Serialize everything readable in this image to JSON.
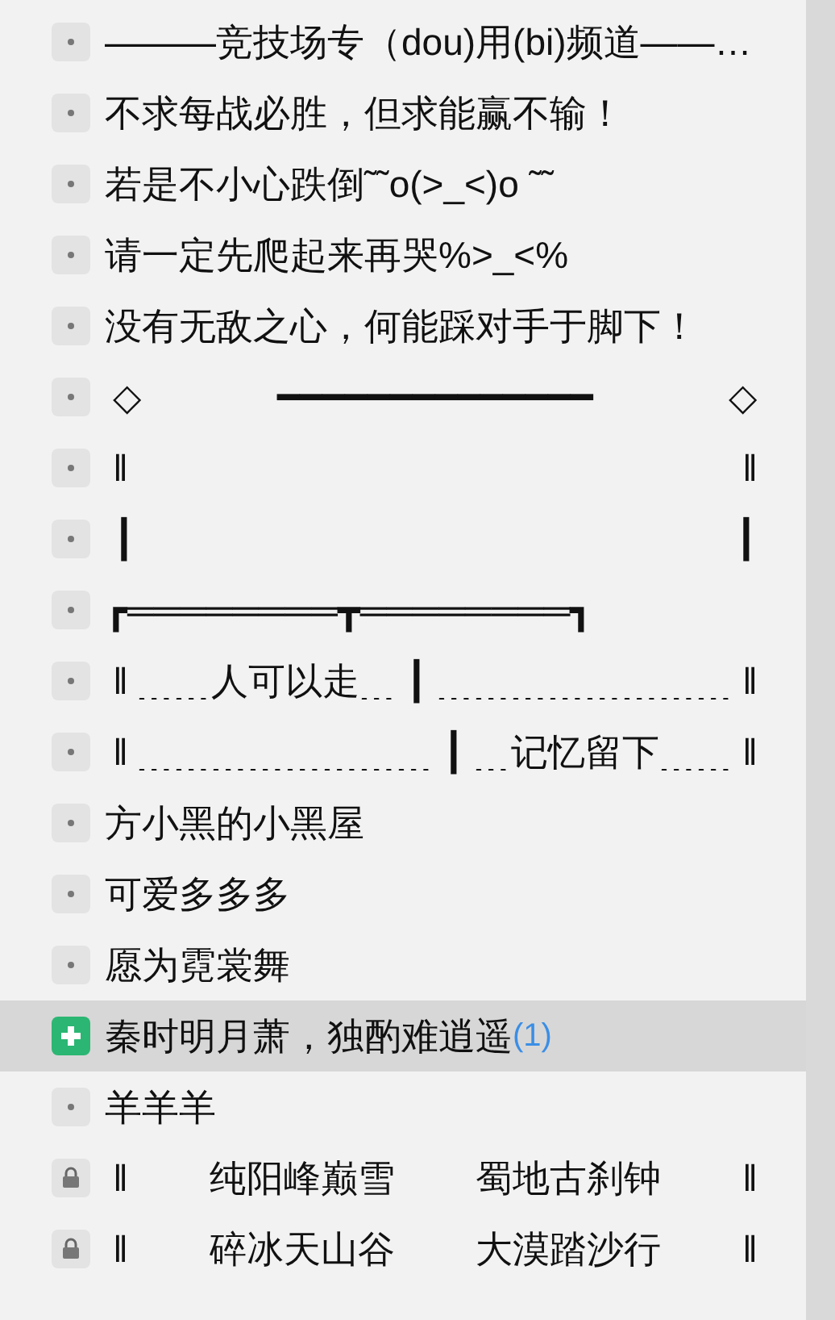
{
  "channels": [
    {
      "kind": "dot",
      "selected": false,
      "segments": [
        "———竞技场专（dou)用(bi)频道——…"
      ]
    },
    {
      "kind": "dot",
      "selected": false,
      "segments": [
        "不求每战必胜，但求能赢不输！"
      ]
    },
    {
      "kind": "dot",
      "selected": false,
      "segments": [
        "若是不小心跌倒˜˜o(>_<)o ˜˜"
      ]
    },
    {
      "kind": "dot",
      "selected": false,
      "segments": [
        "请一定先爬起来再哭%>_<%"
      ]
    },
    {
      "kind": "dot",
      "selected": false,
      "segments": [
        "没有无敌之心，何能踩对手于脚下！"
      ]
    },
    {
      "kind": "dot",
      "selected": false,
      "segments": [
        "◇",
        "━━━━━━━━━━━━━━",
        "◇"
      ]
    },
    {
      "kind": "dot",
      "selected": false,
      "segments": [
        "‖",
        "‖"
      ]
    },
    {
      "kind": "dot",
      "selected": false,
      "segments": [
        "┃",
        "┃"
      ]
    },
    {
      "kind": "dot",
      "selected": false,
      "segments": [
        "┏════════┳════════┓"
      ]
    },
    {
      "kind": "dot",
      "selected": false,
      "segments": [
        "‖",
        "﹍﹍人可以走﹍",
        "┃",
        "﹍﹍﹍﹍﹍﹍﹍﹍",
        "‖"
      ]
    },
    {
      "kind": "dot",
      "selected": false,
      "segments": [
        "‖",
        "﹍﹍﹍﹍﹍﹍﹍﹍",
        "┃",
        "﹍记忆留下﹍﹍",
        "‖"
      ]
    },
    {
      "kind": "dot",
      "selected": false,
      "segments": [
        "方小黑的小黑屋"
      ]
    },
    {
      "kind": "dot",
      "selected": false,
      "segments": [
        "可爱多多多"
      ]
    },
    {
      "kind": "dot",
      "selected": false,
      "segments": [
        "愿为霓裳舞"
      ]
    },
    {
      "kind": "plus",
      "selected": true,
      "segments": [
        "秦时明月萧，独酌难逍遥"
      ],
      "count": "(1)"
    },
    {
      "kind": "dot",
      "selected": false,
      "segments": [
        "羊羊羊"
      ]
    },
    {
      "kind": "lock",
      "selected": false,
      "segments": [
        "‖",
        "纯阳峰巅雪",
        "蜀地古刹钟",
        "‖"
      ]
    },
    {
      "kind": "lock",
      "selected": false,
      "segments": [
        "‖",
        "碎冰天山谷",
        "大漠踏沙行",
        "‖"
      ]
    }
  ]
}
